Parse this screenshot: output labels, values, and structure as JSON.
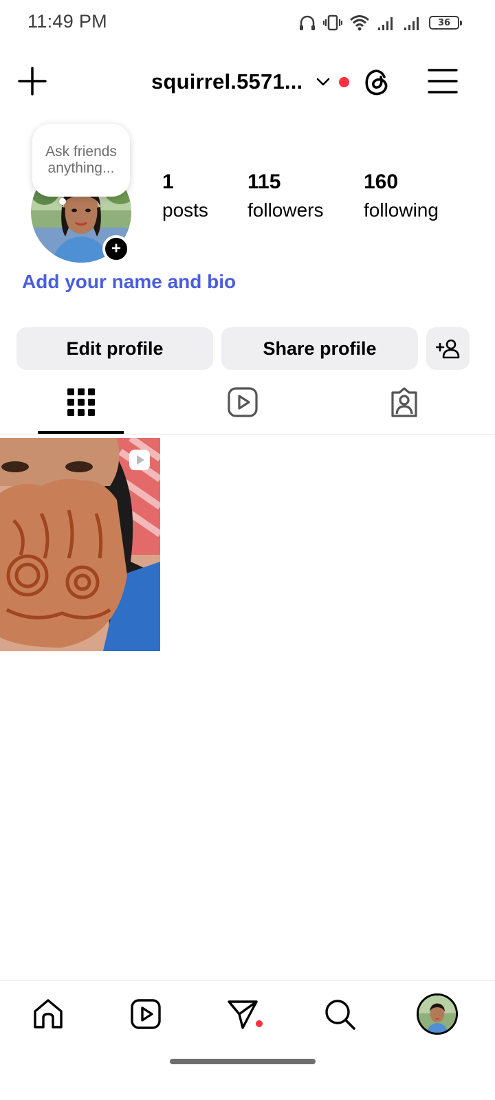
{
  "status_bar": {
    "time": "11:49 PM",
    "battery": "36",
    "icons": [
      "headphones-icon",
      "vibrate-icon",
      "wifi-icon",
      "signal-icon",
      "signal-icon",
      "battery-icon"
    ]
  },
  "header": {
    "username": "squirrel.5571...",
    "icons": [
      "plus-icon",
      "chevron-down-icon",
      "threads-icon",
      "menu-icon"
    ],
    "notification_color": "#ff3040"
  },
  "profile": {
    "note": "Ask friends anything...",
    "stats": [
      {
        "count": "1",
        "label": "posts"
      },
      {
        "count": "115",
        "label": "followers"
      },
      {
        "count": "160",
        "label": "following"
      }
    ],
    "bio_link": "Add your name and bio",
    "bio_link_color": "#4a5de0"
  },
  "actions": {
    "edit_profile": "Edit profile",
    "share_profile": "Share profile"
  },
  "tabs": [
    {
      "icon": "grid-icon",
      "active": true
    },
    {
      "icon": "reels-icon",
      "active": false
    },
    {
      "icon": "tagged-icon",
      "active": false
    }
  ],
  "bottom_nav": [
    "home-icon",
    "reels-icon",
    "messages-icon",
    "search-icon",
    "profile-avatar"
  ]
}
